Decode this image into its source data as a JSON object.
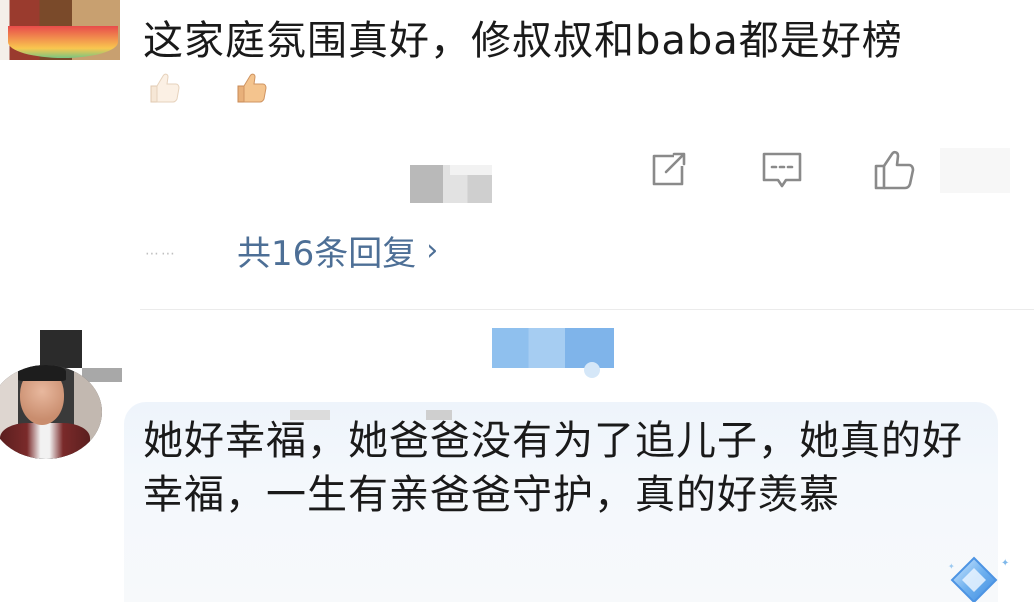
{
  "comment1": {
    "text": "这家庭氛围真好，修叔叔和baba都是好榜",
    "emoji": [
      "thumbs-up-light-skin-icon",
      "thumbs-up-medium-light-skin-icon"
    ],
    "actions": [
      "share-icon",
      "comment-icon",
      "like-icon"
    ],
    "dots": "⋯⋯",
    "replies_label": "共16条回复",
    "replies_chevron": "›"
  },
  "comment2": {
    "text": "她好幸福，她爸爸没有为了追儿子，她真的好幸福，一生有亲爸爸守护，真的好羡慕"
  },
  "colors": {
    "reply_link": "#4d6f96",
    "bubble_bg": "#eef4fb",
    "text": "#1a1a1a",
    "icon": "#8a8a8a"
  }
}
